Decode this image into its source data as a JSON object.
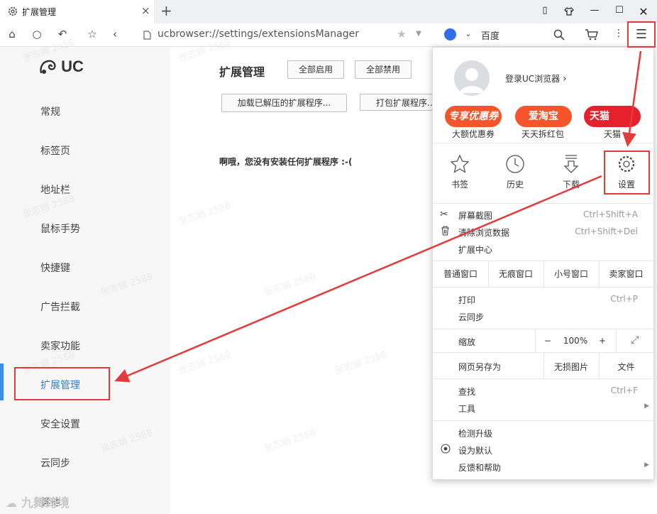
{
  "tab": {
    "title": "扩展管理",
    "close": "×",
    "new_tab": "+"
  },
  "window": {
    "controls": [
      "restore-icon",
      "skin-icon",
      "minimize",
      "maximize",
      "close"
    ]
  },
  "address": {
    "url": "ucbrowser://settings/extensionsManager",
    "search_engine": "百度"
  },
  "sidebar": {
    "logo": "UC",
    "items": [
      "常规",
      "标签页",
      "地址栏",
      "鼠标手势",
      "快捷键",
      "广告拦截",
      "卖家功能",
      "扩展管理",
      "安全设置",
      "云同步",
      "其他"
    ],
    "active_index": 7
  },
  "main": {
    "title": "扩展管理",
    "enable_all": "全部启用",
    "disable_all": "全部禁用",
    "load_unpacked": "加载已解压的扩展程序...",
    "pack": "打包扩展程序...",
    "empty_message": "啊哦，您没有安装任何扩展程序 :-("
  },
  "menu": {
    "login": "登录UC浏览器",
    "promos": [
      {
        "badge": "专享优惠券",
        "label": "大额优惠券",
        "color": "#f5552a"
      },
      {
        "badge": "爱淘宝",
        "label": "天天拆红包",
        "color": "#f5552a"
      },
      {
        "badge": "天猫",
        "label": "天猫",
        "color": "#e5212d"
      }
    ],
    "icons": [
      {
        "label": "书签",
        "icon": "star-icon"
      },
      {
        "label": "历史",
        "icon": "clock-icon"
      },
      {
        "label": "下载",
        "icon": "download-icon"
      },
      {
        "label": "设置",
        "icon": "gear-icon"
      }
    ],
    "screenshot": {
      "label": "屏幕截图",
      "shortcut": "Ctrl+Shift+A"
    },
    "clear_data": {
      "label": "清除浏览数据",
      "shortcut": "Ctrl+Shift+Del"
    },
    "extensions": "扩展中心",
    "windows": [
      "普通窗口",
      "无痕窗口",
      "小号窗口",
      "卖家窗口"
    ],
    "print": {
      "label": "打印",
      "shortcut": "Ctrl+P"
    },
    "cloud_sync": "云同步",
    "zoom": {
      "label": "缩放",
      "minus": "−",
      "value": "100%",
      "plus": "+"
    },
    "save_as": "网页另存为",
    "lossless": "无损图片",
    "file": "文件",
    "find": {
      "label": "查找",
      "shortcut": "Ctrl+F"
    },
    "tools": "工具",
    "check_update": "检测升级",
    "set_default": "设为默认",
    "feedback": "反馈和帮助"
  },
  "watermarks": {
    "text": "张志娟 2588",
    "corner": "九舞跨境"
  },
  "annotations": {
    "color": "#e23b3b"
  }
}
